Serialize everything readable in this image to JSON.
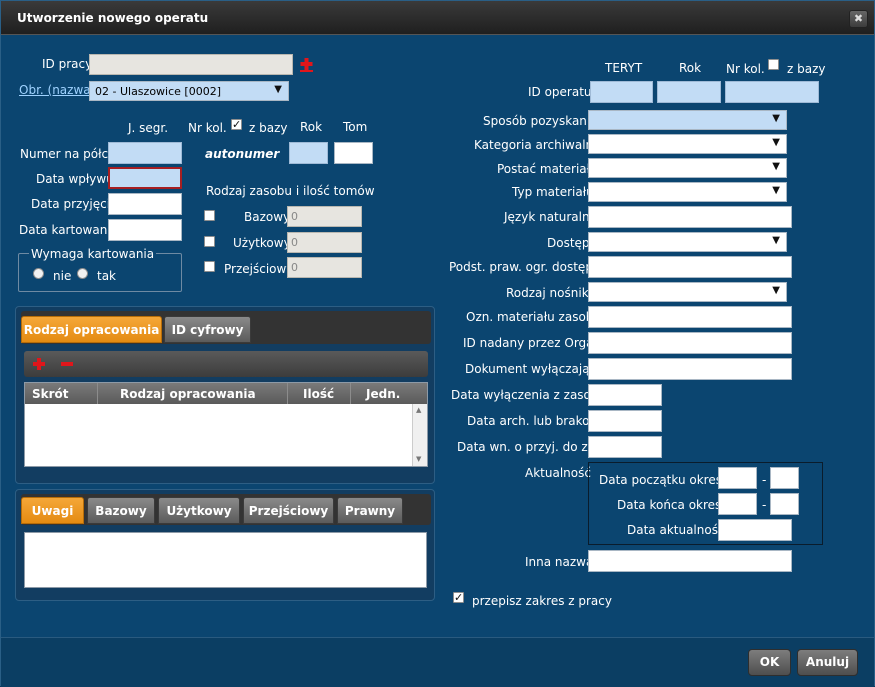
{
  "title": "Utworzenie nowego operatu",
  "close_icon": "close-icon",
  "left": {
    "id_pracy_label": "ID pracy",
    "obr_label": "Obr. (nazwa)",
    "obr_value": "02 - Ulaszowice [0002]",
    "col_jsegr": "J. segr.",
    "col_nrkol": "Nr kol.",
    "col_zbazy": "z bazy",
    "col_rok": "Rok",
    "col_tom": "Tom",
    "numer_label": "Numer na półce",
    "autonumer": "autonumer",
    "data_wplywu": "Data wpływu",
    "data_przyjecia": "Data przyjęcia",
    "data_kartowania": "Data kartowania",
    "wymaga": "Wymaga kartowania",
    "nie": "nie",
    "tak": "tak",
    "rodzaj_zasobu": "Rodzaj zasobu i ilość tomów",
    "bazowy": "Bazowy",
    "uzytkowy": "Użytkowy",
    "przejsciowy": "Przejściowy",
    "bazowy_val": "0",
    "uzytkowy_val": "0",
    "przejsciowy_val": "0"
  },
  "panel1": {
    "tabs": [
      "Rodzaj opracowania",
      "ID cyfrowy"
    ],
    "columns": [
      "Skrót",
      "Rodzaj opracowania",
      "Ilość",
      "Jedn."
    ]
  },
  "panel2": {
    "tabs": [
      "Uwagi",
      "Bazowy",
      "Użytkowy",
      "Przejściowy",
      "Prawny"
    ]
  },
  "right": {
    "teryt": "TERYT",
    "rok": "Rok",
    "nrkol": "Nr kol.",
    "zbazy": "z bazy",
    "id_operatu": "ID operatu",
    "sposob": "Sposób pozyskania",
    "kategoria": "Kategoria archiwalna",
    "postac": "Postać materiału",
    "typ": "Typ materiału",
    "jezyk": "Język naturalny",
    "dostep": "Dostęp",
    "podst": "Podst. praw. ogr. dostępu",
    "nosnik": "Rodzaj nośnika",
    "ozn": "Ozn. materiału zasobu",
    "id_nadany": "ID nadany przez Organ",
    "dokument": "Dokument wyłączający",
    "data_wyl": "Data wyłączenia z zasobu",
    "data_arch": "Data arch. lub brakow.",
    "data_wn": "Data wn. o przyj. do zas.",
    "aktualnosc": "Aktualność",
    "data_pocz": "Data początku okresu",
    "data_konca": "Data końca okresu",
    "data_akt": "Data aktualności",
    "dash": "-",
    "inna": "Inna nazwa",
    "przepisz": "przepisz zakres z pracy"
  },
  "buttons": {
    "ok": "OK",
    "anuluj": "Anuluj"
  },
  "colors": {
    "accent": "#e48b12",
    "background": "#0b4570",
    "error_border": "#a61f22",
    "plus": "#e0161b"
  }
}
